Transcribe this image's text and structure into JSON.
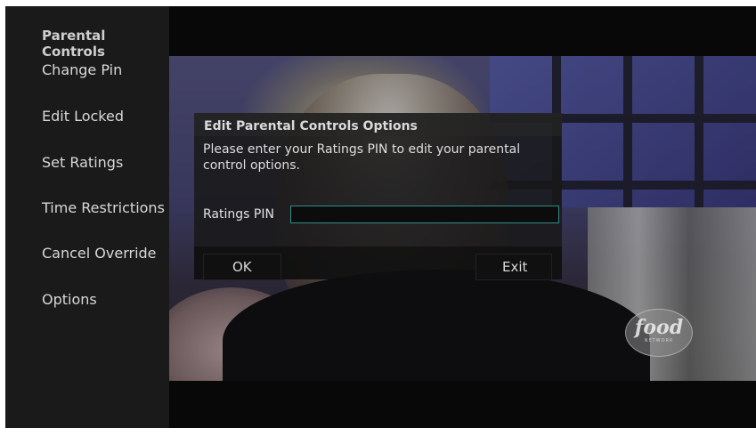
{
  "panel": {
    "title": "Parental Controls"
  },
  "menu": {
    "items": [
      {
        "label": "Change Pin"
      },
      {
        "label": "Edit Locked"
      },
      {
        "label": "Set Ratings"
      },
      {
        "label": "Time Restrictions"
      },
      {
        "label": "Cancel Override"
      },
      {
        "label": "Options"
      }
    ]
  },
  "video": {
    "logo_text": "food",
    "logo_subtext": "NETWORK"
  },
  "dialog": {
    "title": "Edit Parental Controls Options",
    "message": "Please enter your Ratings PIN to edit your parental control options.",
    "pin_label": "Ratings PIN",
    "pin_value": "",
    "ok_label": "OK",
    "exit_label": "Exit"
  },
  "colors": {
    "input_border": "#2f8f86",
    "panel_bg": "#1a1a1a",
    "dialog_bg": "#181818"
  },
  "icons": [
    "food-network-logo-icon"
  ]
}
